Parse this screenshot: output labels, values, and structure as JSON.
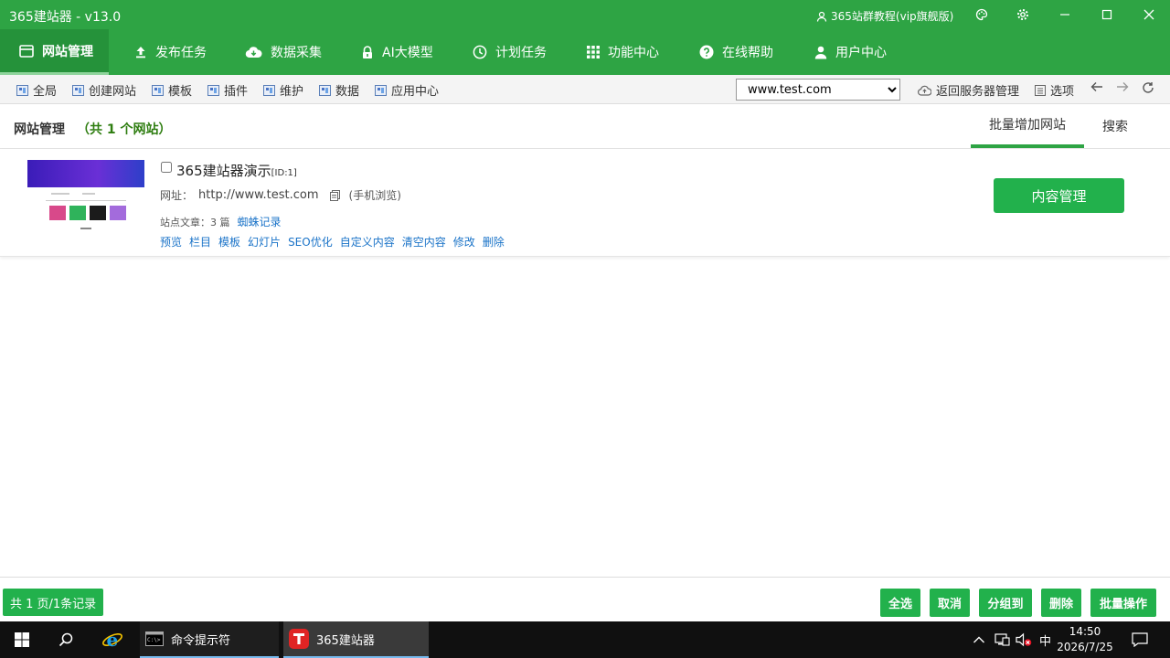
{
  "titlebar": {
    "app_title": "365建站器 - v13.0",
    "tutorial": "365站群教程(vip旗舰版)"
  },
  "mainnav": {
    "items": [
      {
        "label": "网站管理",
        "icon": "website-icon",
        "active": true
      },
      {
        "label": "发布任务",
        "icon": "upload-icon"
      },
      {
        "label": "数据采集",
        "icon": "cloud-download-icon"
      },
      {
        "label": "AI大模型",
        "icon": "lock-icon"
      },
      {
        "label": "计划任务",
        "icon": "clock-icon"
      },
      {
        "label": "功能中心",
        "icon": "grid-icon"
      },
      {
        "label": "在线帮助",
        "icon": "help-icon"
      },
      {
        "label": "用户中心",
        "icon": "user-icon"
      }
    ]
  },
  "toolbar": {
    "items": [
      "全局",
      "创建网站",
      "模板",
      "插件",
      "维护",
      "数据",
      "应用中心"
    ],
    "site_select": "www.test.com",
    "back_server": "返回服务器管理",
    "options": "选项"
  },
  "section": {
    "title": "网站管理",
    "count": "（共 1 个网站）",
    "tab_add": "批量增加网站",
    "tab_search": "搜索"
  },
  "site": {
    "name": "365建站器演示",
    "id": "[ID:1]",
    "url_label": "网址：",
    "url": "http://www.test.com",
    "mobile": "(手机浏览)",
    "stats": "站点文章：3 篇",
    "spider": "蜘蛛记录",
    "actions": [
      "预览",
      "栏目",
      "模板",
      "幻灯片",
      "SEO优化",
      "自定义内容",
      "清空内容",
      "修改",
      "删除"
    ],
    "content_btn": "内容管理"
  },
  "bottom": {
    "page_info": "共 1 页/1条记录",
    "buttons": [
      "全选",
      "取消",
      "分组到",
      "删除",
      "批量操作"
    ]
  },
  "taskbar": {
    "cmd_label": "命令提示符",
    "app_label": "365建站器",
    "ime": "中",
    "time": "14:50",
    "date": "2026/7/25"
  },
  "colors": {
    "brand_green": "#2ea444",
    "button_green": "#22b14c",
    "link_blue": "#1a73c8",
    "count_green": "#2e7d10"
  }
}
